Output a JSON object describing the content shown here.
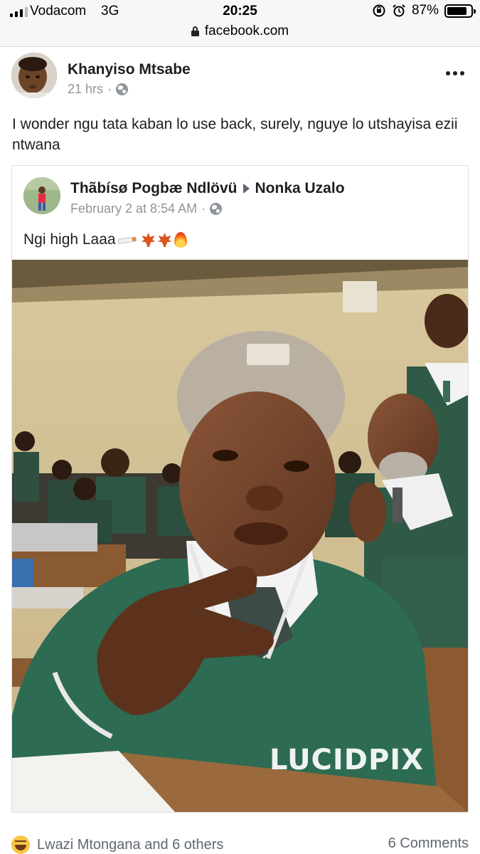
{
  "status_bar": {
    "carrier": "Vodacom",
    "network": "3G",
    "time": "20:25",
    "battery": "87%",
    "battery_level": 0.87,
    "url": "facebook.com"
  },
  "post": {
    "author": "Khanyiso Mtsabe",
    "time": "21 hrs",
    "separator": "·",
    "text": "I wonder ngu tata kaban lo use back, surely, nguye lo utshayisa ezii ntwana"
  },
  "shared_post": {
    "author": "Thãbísø Pogbæ Ndlövü",
    "target": "Nonka Uzalo",
    "time": "February 2 at 8:54 AM",
    "separator": "·",
    "text": "Ngi high Laaa",
    "emojis": [
      "cigarette-emoji",
      "maple-leaf-emoji",
      "maple-leaf-emoji",
      "fire-emoji"
    ],
    "photo_watermark": "LUCIDPIX"
  },
  "footer": {
    "reactions_text": "Lwazi Mtongana and 6 others",
    "comments_text": "6 Comments"
  }
}
